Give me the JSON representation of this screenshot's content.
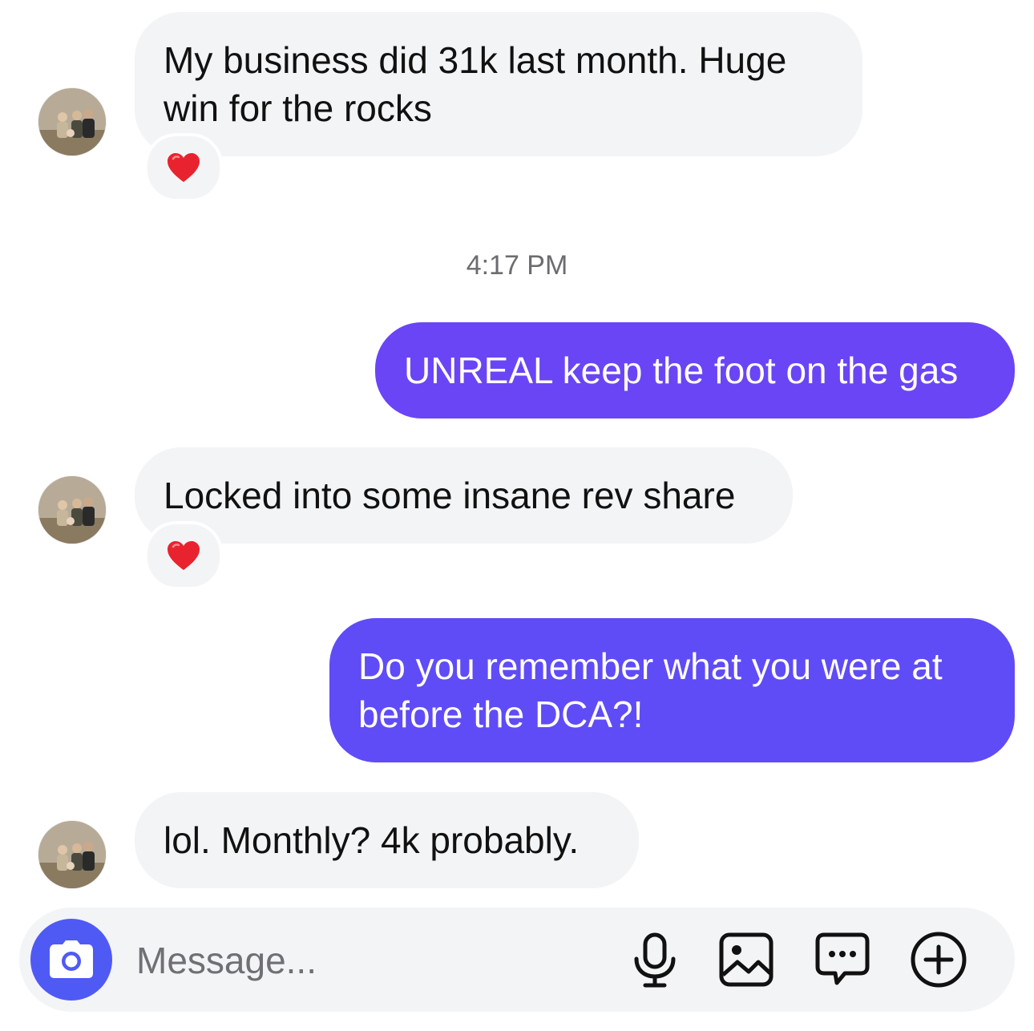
{
  "messages": [
    {
      "direction": "incoming",
      "text_line1": "My business did 31k last month. Huge",
      "text_line2": "win for the rocks",
      "reaction": "heart"
    },
    {
      "timestamp": "4:17 PM"
    },
    {
      "direction": "outgoing",
      "text": "UNREAL keep the foot on the gas"
    },
    {
      "direction": "incoming",
      "text": "Locked into some insane rev share",
      "reaction": "heart"
    },
    {
      "direction": "outgoing",
      "text_line1": "Do you remember what you were at",
      "text_line2": "before the DCA?!"
    },
    {
      "direction": "incoming",
      "text": "lol. Monthly? 4k probably."
    }
  ],
  "composer": {
    "placeholder": "Message...",
    "icons": [
      "camera-icon",
      "microphone-icon",
      "gallery-icon",
      "sticker-chat-icon",
      "plus-circle-icon"
    ]
  },
  "colors": {
    "incoming_bubble": "#f3f4f6",
    "outgoing_bubble_1": "#6a45f6",
    "outgoing_bubble_2": "#5f4cf7",
    "camera_button": "#4f5af5",
    "reaction_heart": "#e8232f"
  }
}
